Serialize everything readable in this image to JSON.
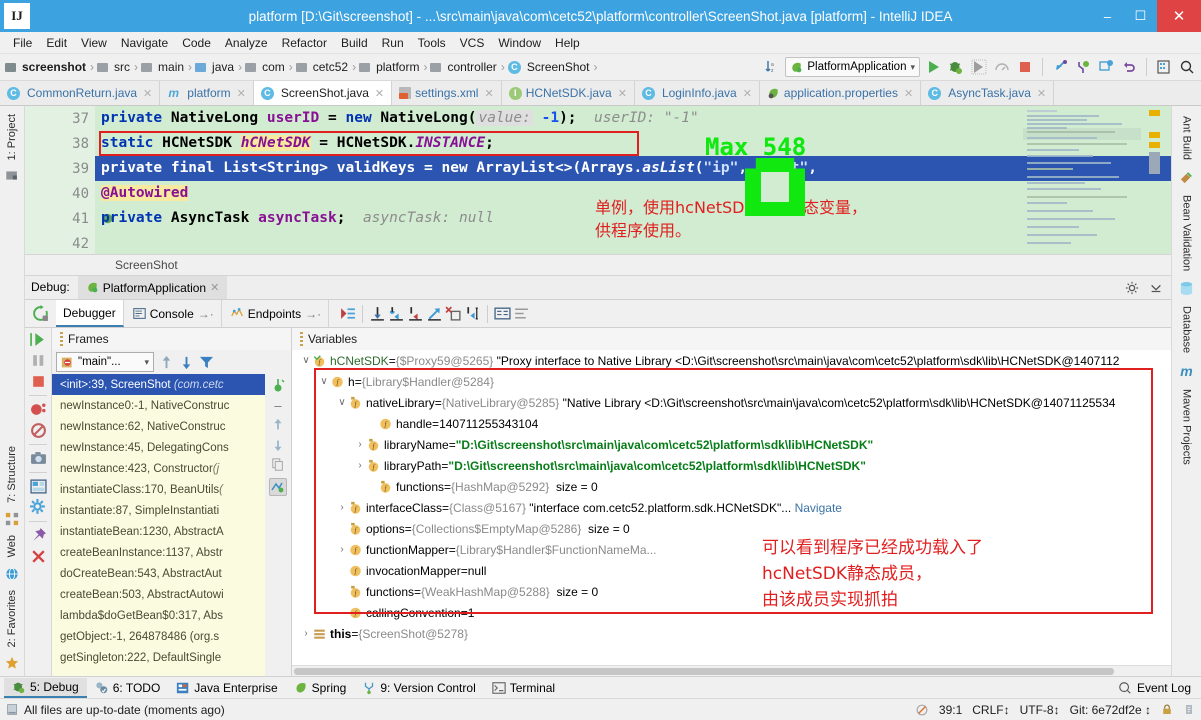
{
  "window": {
    "title": "platform [D:\\Git\\screenshot] - ...\\src\\main\\java\\com\\cetc52\\platform\\controller\\ScreenShot.java [platform] - IntelliJ IDEA",
    "logo": "IJ",
    "minimize": "–",
    "maximize": "⬜",
    "close": "✕"
  },
  "menu": {
    "items": [
      "File",
      "Edit",
      "View",
      "Navigate",
      "Code",
      "Analyze",
      "Refactor",
      "Build",
      "Run",
      "Tools",
      "VCS",
      "Window",
      "Help"
    ]
  },
  "navbar": {
    "crumbs": [
      {
        "label": "screenshot",
        "icon": "module-icon"
      },
      {
        "label": "src",
        "icon": "folder-icon"
      },
      {
        "label": "main",
        "icon": "folder-icon"
      },
      {
        "label": "java",
        "icon": "source-folder-icon"
      },
      {
        "label": "com",
        "icon": "package-icon"
      },
      {
        "label": "cetc52",
        "icon": "package-icon"
      },
      {
        "label": "platform",
        "icon": "package-icon"
      },
      {
        "label": "controller",
        "icon": "package-icon"
      },
      {
        "label": "ScreenShot",
        "icon": "class-icon"
      }
    ],
    "separator": "›",
    "run_config": "PlatformApplication",
    "run_config_caret": "∨",
    "icons": [
      "sort-icon",
      "run-icon",
      "debug-icon",
      "run-coverage-icon",
      "profiler-icon",
      "stop-icon",
      "step-into-icon",
      "toggle-breakpoint-icon",
      "update-app-icon",
      "revert-icon",
      "project-structure-icon",
      "search-icon"
    ]
  },
  "editor_tabs": [
    {
      "label": "CommonReturn.java",
      "icon": "class-icon",
      "active": false
    },
    {
      "label": "platform",
      "icon": "module-icon",
      "active": false
    },
    {
      "label": "ScreenShot.java",
      "icon": "class-icon",
      "active": true
    },
    {
      "label": "settings.xml",
      "icon": "xml-icon",
      "active": false
    },
    {
      "label": "HCNetSDK.java",
      "icon": "interface-icon",
      "active": false
    },
    {
      "label": "LoginInfo.java",
      "icon": "class-icon",
      "active": false
    },
    {
      "label": "application.properties",
      "icon": "spring-properties-icon",
      "active": false
    },
    {
      "label": "AsyncTask.java",
      "icon": "class-icon",
      "active": false
    }
  ],
  "tab_close": "✕",
  "editor": {
    "lines": [
      {
        "no": "37",
        "marker": "",
        "text_html": "37"
      },
      {
        "no": "38",
        "marker": "",
        "text_html": "38"
      },
      {
        "no": "39",
        "marker": "breakpoint-muted-icon",
        "text_html": "39"
      },
      {
        "no": "40",
        "marker": "",
        "text_html": "40"
      },
      {
        "no": "41",
        "marker": "run-gutter-icon",
        "text_html": "41"
      },
      {
        "no": "42",
        "marker": "",
        "text_html": "42"
      }
    ],
    "code": [
      "private NativeLong userID = new NativeLong( value: -1);   userID: \"-1\"",
      "static HCNetSDK hCNetSDK = HCNetSDK.INSTANCE;",
      "private final List<String> validKeys = new ArrayList<>(Arrays.asList(\"ip\", \"port\",",
      "@Autowired",
      "private AsyncTask asyncTask;   asyncTask: null",
      ""
    ],
    "annotation_cn_line1": "单例，使用hcNetSDK引入静态变量，",
    "annotation_cn_line2": "供程序使用。",
    "overlay_green_text": "Max  548",
    "breadcrumb": "ScreenShot"
  },
  "left_rail": [
    {
      "label": "1: Project",
      "icon": "project-icon"
    },
    {
      "label": "7: Structure",
      "icon": "structure-icon"
    },
    {
      "label": "Web",
      "icon": "web-icon"
    },
    {
      "label": "2: Favorites",
      "icon": "favorites-icon"
    }
  ],
  "right_rail": [
    {
      "label": "Ant Build",
      "icon": "ant-icon"
    },
    {
      "label": "Bean Validation",
      "icon": "bean-validation-icon"
    },
    {
      "label": "Database",
      "icon": "database-icon"
    },
    {
      "label": "Maven Projects",
      "icon": "maven-icon"
    }
  ],
  "debug": {
    "header_label": "Debug:",
    "session_tab": "PlatformApplication",
    "session_close": "✕",
    "tabs": [
      {
        "label": "Debugger",
        "icon": "debugger-icon",
        "active": true
      },
      {
        "label": "Console",
        "icon": "console-icon",
        "pin": "→·",
        "active": false
      },
      {
        "label": "Endpoints",
        "icon": "endpoints-icon",
        "pin": "→·",
        "active": false
      }
    ],
    "toolbar_icons": [
      "show-execution-point-icon",
      "step-over-icon",
      "step-into-icon",
      "force-step-into-icon",
      "step-out-icon",
      "drop-frame-icon",
      "run-to-cursor-icon",
      "evaluate-expression-icon",
      "settings-list-icon"
    ],
    "settings_icon": "gear-icon",
    "hide_icon": "hide-icon",
    "left_toolbar_icons": [
      "resume-icon",
      "pause-icon",
      "stop-icon",
      "view-breakpoints-icon",
      "mute-breakpoints-icon",
      "camera-icon",
      "layout-icon",
      "settings-gear-icon",
      "pin-icon",
      "close-icon"
    ],
    "frames": {
      "title": "Frames",
      "thread": "\"main\"...",
      "thread_caret": "∨",
      "items": [
        {
          "method": "<init>:39, ScreenShot",
          "pkg": "(com.cetc",
          "selected": true
        },
        {
          "method": "newInstance0:-1, NativeConstruc",
          "pkg": "",
          "selected": false
        },
        {
          "method": "newInstance:62, NativeConstruc",
          "pkg": "",
          "selected": false
        },
        {
          "method": "newInstance:45, DelegatingCons",
          "pkg": "",
          "selected": false
        },
        {
          "method": "newInstance:423, Constructor ",
          "pkg": "(j",
          "selected": false
        },
        {
          "method": "instantiateClass:170, BeanUtils ",
          "pkg": "(",
          "selected": false
        },
        {
          "method": "instantiate:87, SimpleInstantiati",
          "pkg": "",
          "selected": false
        },
        {
          "method": "instantiateBean:1230, AbstractA",
          "pkg": "",
          "selected": false
        },
        {
          "method": "createBeanInstance:1137, Abstr",
          "pkg": "",
          "selected": false
        },
        {
          "method": "doCreateBean:543, AbstractAut",
          "pkg": "",
          "selected": false
        },
        {
          "method": "createBean:503, AbstractAutowi",
          "pkg": "",
          "selected": false
        },
        {
          "method": "lambda$doGetBean$0:317, Abs",
          "pkg": "",
          "selected": false
        },
        {
          "method": "getObject:-1, 264878486 (org.s",
          "pkg": "",
          "selected": false
        },
        {
          "method": "getSingleton:222, DefaultSingle",
          "pkg": "",
          "selected": false
        }
      ]
    },
    "variables": {
      "title": "Variables",
      "rows": [
        {
          "indent": 0,
          "arrow": "∨",
          "icon": "static-field-icon",
          "name": "hCNetSDK",
          "eq": " = ",
          "ref": "{$Proxy59@5265}",
          "value": "\"Proxy interface to Native Library <D:\\Git\\screenshot\\src\\main\\java\\com\\cetc52\\platform\\sdk\\lib\\HCNetSDK@1407112",
          "value_style": "plain"
        },
        {
          "indent": 1,
          "arrow": "∨",
          "icon": "field-icon",
          "name": "h",
          "eq": " = ",
          "ref": "{Library$Handler@5284}",
          "value": "",
          "value_style": "plain"
        },
        {
          "indent": 2,
          "arrow": "∨",
          "icon": "final-field-icon",
          "name": "nativeLibrary",
          "eq": " = ",
          "ref": "{NativeLibrary@5285}",
          "value": "\"Native Library <D:\\Git\\screenshot\\src\\main\\java\\com\\cetc52\\platform\\sdk\\lib\\HCNetSDK@14071125534",
          "value_style": "plain"
        },
        {
          "indent": 3,
          "arrow": "",
          "icon": "field-icon",
          "name": "handle",
          "eq": " = ",
          "ref": "",
          "value": "140711255343104",
          "value_style": "plain"
        },
        {
          "indent": 3,
          "arrow": "›",
          "icon": "final-field-icon",
          "name": "libraryName",
          "eq": " = ",
          "ref": "",
          "value": "\"D:\\Git\\screenshot\\src\\main\\java\\com\\cetc52\\platform\\sdk\\lib\\HCNetSDK\"",
          "value_style": "string"
        },
        {
          "indent": 3,
          "arrow": "›",
          "icon": "final-field-icon",
          "name": "libraryPath",
          "eq": " = ",
          "ref": "",
          "value": "\"D:\\Git\\screenshot\\src\\main\\java\\com\\cetc52\\platform\\sdk\\lib\\HCNetSDK\"",
          "value_style": "string"
        },
        {
          "indent": 3,
          "arrow": "",
          "icon": "final-field-icon",
          "name": "functions",
          "eq": " = ",
          "ref": "{HashMap@5292}",
          "value": "size = 0",
          "value_style": "plain"
        },
        {
          "indent": 2,
          "arrow": "›",
          "icon": "final-field-icon",
          "name": "interfaceClass",
          "eq": " = ",
          "ref": "{Class@5167}",
          "value": "\"interface com.cetc52.platform.sdk.HCNetSDK\"...",
          "value_style": "plain",
          "link": "Navigate"
        },
        {
          "indent": 2,
          "arrow": "",
          "icon": "final-field-icon",
          "name": "options",
          "eq": " = ",
          "ref": "{Collections$EmptyMap@5286}",
          "value": "size = 0",
          "value_style": "plain"
        },
        {
          "indent": 2,
          "arrow": "›",
          "icon": "field-icon",
          "name": "functionMapper",
          "eq": " = ",
          "ref": "{Library$Handler$FunctionNameMa...",
          "value": "",
          "value_style": "plain"
        },
        {
          "indent": 2,
          "arrow": "",
          "icon": "field-icon",
          "name": "invocationMapper",
          "eq": " = ",
          "ref": "",
          "value": "null",
          "value_style": "plain"
        },
        {
          "indent": 2,
          "arrow": "",
          "icon": "final-field-icon",
          "name": "functions",
          "eq": " = ",
          "ref": "{WeakHashMap@5288}",
          "value": "size = 0",
          "value_style": "plain"
        },
        {
          "indent": 2,
          "arrow": "",
          "icon": "field-icon",
          "name": "callingConvention",
          "eq": " = ",
          "ref": "",
          "value": "1",
          "value_style": "plain"
        },
        {
          "indent": 0,
          "arrow": "›",
          "icon": "this-icon",
          "name": "this",
          "eq": " = ",
          "ref": "{ScreenShot@5278}",
          "value": "",
          "value_style": "plain"
        }
      ],
      "annotation_cn": [
        "可以看到程序已经成功载入了",
        "hcNetSDK静态成员，",
        "由该成员实现抓拍"
      ]
    }
  },
  "toolwindow_bar": [
    {
      "label": "5: Debug",
      "icon": "debug-icon",
      "active": true
    },
    {
      "label": "6: TODO",
      "icon": "todo-icon",
      "active": false
    },
    {
      "label": "Java Enterprise",
      "icon": "java-ee-icon",
      "active": false
    },
    {
      "label": "Spring",
      "icon": "spring-icon",
      "active": false
    },
    {
      "label": "9: Version Control",
      "icon": "vcs-icon",
      "active": false
    },
    {
      "label": "Terminal",
      "icon": "terminal-icon",
      "active": false
    }
  ],
  "event_log": {
    "label": "Event Log",
    "icon": "event-log-icon"
  },
  "statusbar": {
    "message": "All files are up-to-date (moments ago)",
    "caret": "39:1",
    "line_sep": "CRLF↕",
    "encoding": "UTF-8↕",
    "git": "Git: 6e72df2e ↕",
    "lock_icon": "lock-icon",
    "inspect_icon": "inspection-icon",
    "hector_icon": "hector-icon"
  },
  "colors": {
    "title_bg": "#3da2e0",
    "close_btn": "#e04343",
    "editor_bg": "#d2ecd2",
    "selection": "#2b55b0",
    "annotation_red": "#e02020",
    "overlay_green": "#10e810",
    "string_green": "#067d17",
    "keyword_blue": "#0033b3",
    "field_purple": "#871094"
  }
}
